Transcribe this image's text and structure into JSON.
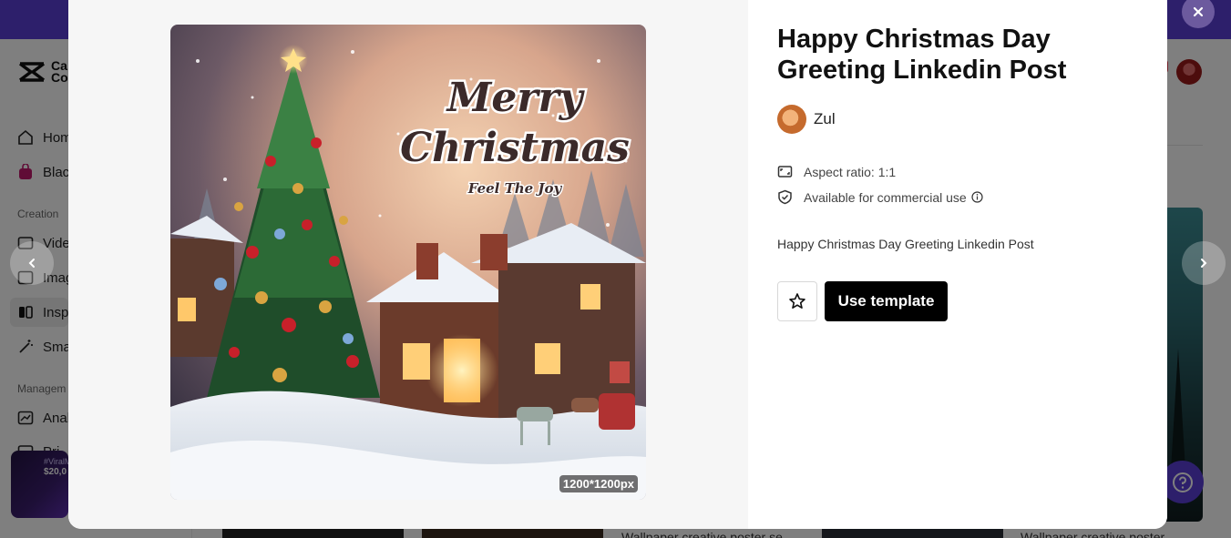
{
  "background": {
    "logo_text": "Ca\nCo",
    "sidebar": {
      "items_top": [
        {
          "label": "Hom",
          "icon": "home-icon"
        },
        {
          "label": "Blac",
          "icon": "bag-icon"
        }
      ],
      "creation_label": "Creation",
      "items_creation": [
        {
          "label": "Vide",
          "icon": "video-icon"
        },
        {
          "label": "Imag",
          "icon": "image-icon"
        },
        {
          "label": "Insp",
          "icon": "inspiration-icon"
        },
        {
          "label": "Sma",
          "icon": "magic-wand-icon"
        }
      ],
      "management_label": "Managem",
      "items_management": [
        {
          "label": "Anal",
          "icon": "analytics-icon"
        },
        {
          "label": "Pri",
          "icon": "calendar-icon"
        }
      ]
    },
    "promo": {
      "line1": "#ViralM",
      "line2": "$20,0"
    },
    "bottom_texts": [
      "Wallpaper creative poster se",
      "Wallpaper creative poster"
    ]
  },
  "modal": {
    "title": "Happy Christmas Day Greeting Linkedin Post",
    "author": "Zul",
    "aspect_ratio": "Aspect ratio: 1:1",
    "commercial": "Available for commercial use",
    "description": "Happy Christmas Day Greeting Linkedin Post",
    "use_template": "Use template",
    "image_dims": "1200*1200px",
    "image_text": {
      "line1": "Merry",
      "line2": "Christmas",
      "line3": "Feel The Joy"
    }
  },
  "colors": {
    "brand": "#5b3fd6",
    "button": "#000000"
  }
}
